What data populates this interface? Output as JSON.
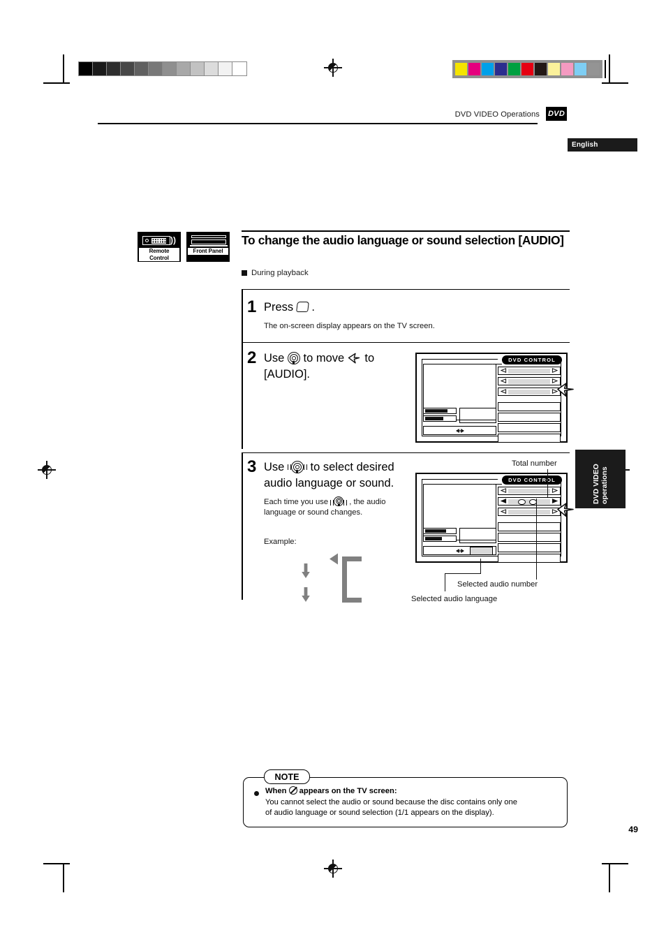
{
  "header": {
    "title": "DVD VIDEO Operations",
    "badge": "DVD",
    "language_tab": "English"
  },
  "side_tab": {
    "line1": "DVD VIDEO",
    "line2": "operations"
  },
  "device_badges": [
    {
      "caption": "Remote Control",
      "icon": "remote-control-icon"
    },
    {
      "caption": "Front Panel",
      "icon": "front-panel-icon"
    }
  ],
  "section": {
    "title": "To change the audio language or sound selection [AUDIO]",
    "subhead": "During playback"
  },
  "steps": [
    {
      "number": "1",
      "head_pre": "Press",
      "head_post": ".",
      "icon": "display-button-icon",
      "body": "The on-screen display appears on the TV screen."
    },
    {
      "number": "2",
      "head_line1_pre": "Use",
      "head_line1_mid": "to move",
      "head_line1_post": "to",
      "head_line2": "[AUDIO].",
      "icon_joystick": "joystick-icon",
      "icon_cursor": "cursor-arrow-icon"
    },
    {
      "number": "3",
      "head_line1_pre": "Use",
      "head_line1_post": "to select desired",
      "head_line2": "audio language or sound.",
      "icon_joystick": "joystick-moving-icon",
      "body_pre": "Each time you use",
      "body_post": ", the audio",
      "body_line2": "language or sound changes.",
      "example_label": "Example:"
    }
  ],
  "screen": {
    "control_tab": "DVD CONTROL"
  },
  "callouts": {
    "total_number": "Total number",
    "selected_audio_number": "Selected audio number",
    "selected_audio_language": "Selected audio language"
  },
  "note": {
    "tag": "NOTE",
    "line1_pre": "When",
    "line1_post": "appears on the TV screen:",
    "line2": "You cannot select the audio or sound because the disc contains only one",
    "line3": "of audio language or sound selection (1/1 appears on the display)."
  },
  "page_number": "49",
  "calibration": {
    "grayscale": [
      "#000000",
      "#1a1a1a",
      "#2e2e2e",
      "#474747",
      "#606060",
      "#787878",
      "#8f8f8f",
      "#a8a8a8",
      "#c2c2c2",
      "#dcdcdc",
      "#f2f2f2",
      "#ffffff"
    ],
    "colors": [
      "#f5e400",
      "#e5007e",
      "#00a0e9",
      "#2b2d8e",
      "#00a040",
      "#e60012",
      "#231815",
      "#fbf19b",
      "#f49ac1",
      "#7ecef4",
      "#949494"
    ]
  },
  "colors": {
    "ink": "#000000",
    "gray_arrow": "#808080",
    "slot_fill": "#d9d9d9"
  }
}
